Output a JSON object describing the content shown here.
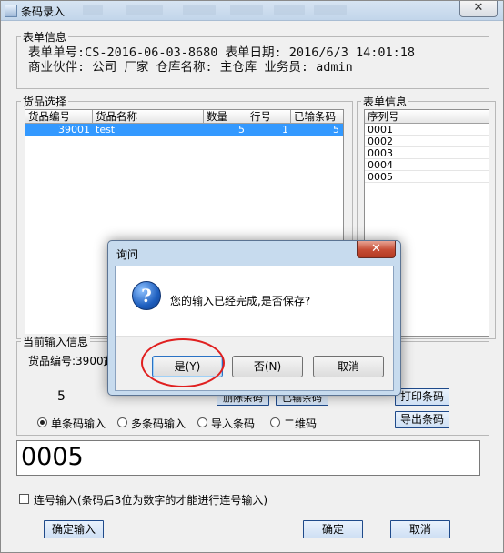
{
  "window": {
    "title": "条码录入",
    "close_label": "✕"
  },
  "form_info": {
    "group_label": "表单信息",
    "line1": "表单单号:CS-2016-06-03-8680 表单日期: 2016/6/3 14:01:18",
    "line2": "商业伙伴: 公司 厂家 仓库名称: 主仓库 业务员: admin"
  },
  "goods": {
    "group_label": "货品选择",
    "columns": [
      "货品编号",
      "货品名称",
      "数量",
      "行号",
      "已输条码"
    ],
    "rows": [
      {
        "code": "39001",
        "name": "test",
        "qty": "5",
        "line": "1",
        "scanned": "5"
      }
    ]
  },
  "serials": {
    "group_label": "表单信息",
    "header": "序列号",
    "items": [
      "0001",
      "0002",
      "0003",
      "0004",
      "0005"
    ]
  },
  "current_input": {
    "group_label": "当前输入信息",
    "goods_code_label": "货品编号:39001",
    "goods_code_tail": "货",
    "count": "5",
    "delete_label": "删除条码",
    "input_label": "已输条码",
    "print_label": "打印条码",
    "export_label": "导出条码"
  },
  "modes": [
    {
      "label": "单条码输入",
      "selected": true
    },
    {
      "label": "多条码输入",
      "selected": false
    },
    {
      "label": "导入条码",
      "selected": false
    },
    {
      "label": "二维码",
      "selected": false
    }
  ],
  "barcode_value": "0005",
  "serial_checkbox_label": "连号输入(条码后3位为数字的才能进行连号输入)",
  "buttons": {
    "confirm_input": "确定输入",
    "ok": "确定",
    "cancel": "取消"
  },
  "dialog": {
    "title": "询问",
    "close_label": "✕",
    "message": "您的输入已经完成,是否保存?",
    "icon_glyph": "?",
    "yes": "是(Y)",
    "no": "否(N)",
    "cancel": "取消"
  }
}
